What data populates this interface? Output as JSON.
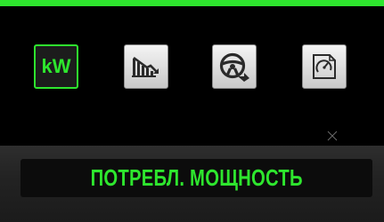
{
  "top_bar": {
    "color": "#2ee62e"
  },
  "mode_buttons": [
    {
      "id": "power",
      "label": "kW",
      "icon": "kw-text",
      "selected": true
    },
    {
      "id": "trend",
      "icon": "declining-bar-chart-icon",
      "selected": false
    },
    {
      "id": "driving",
      "icon": "steering-wheel-arrow-icon",
      "selected": false
    },
    {
      "id": "settings",
      "icon": "gauge-document-icon",
      "selected": false
    }
  ],
  "display": {
    "label": "ПОТРЕБЛ. МОЩНОСТЬ",
    "text_color": "#2ee62e"
  },
  "colors": {
    "accent": "#2ee62e",
    "background": "#000000",
    "panel": "#232323"
  }
}
